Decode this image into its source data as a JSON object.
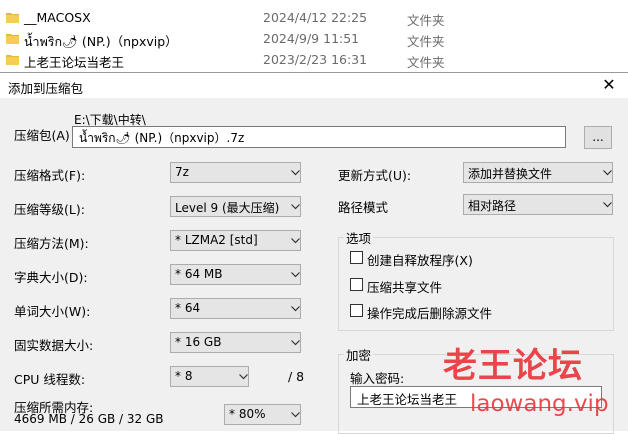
{
  "explorer": {
    "rows": [
      {
        "name": "__MACOSX",
        "date": "2024/4/12 22:25",
        "type": "文件夹"
      },
      {
        "name": "น้ำพริก🌶 (NP.)（npxvip）",
        "date": "2024/9/9 11:51",
        "type": "文件夹"
      },
      {
        "name": "上老王论坛当老王",
        "date": "2023/2/23 16:31",
        "type": "文件夹"
      }
    ]
  },
  "dialog": {
    "title": "添加到压缩包",
    "close": "✕",
    "archive_label": "压缩包(A)",
    "archive_path": "E:\\下载\\中转\\",
    "archive_name": "น้ำพริก🌶 (NP.)（npxvip）.7z",
    "browse": "...",
    "left": [
      {
        "label": "压缩格式(F):",
        "value": "7z"
      },
      {
        "label": "压缩等级(L):",
        "value": "Level 9 (最大压缩)"
      },
      {
        "label": "压缩方法(M):",
        "value": "* LZMA2 [std]"
      },
      {
        "label": "字典大小(D):",
        "value": "* 64 MB"
      },
      {
        "label": "单词大小(W):",
        "value": "* 64"
      },
      {
        "label": "固实数据大小:",
        "value": "* 16 GB"
      }
    ],
    "cpu": {
      "label": "CPU 线程数:",
      "value": "* 8",
      "total": "/ 8"
    },
    "memory": {
      "label": "压缩所需内存:",
      "detail": "4669 MB / 26 GB / 32 GB",
      "value": "* 80%"
    },
    "update": {
      "label": "更新方式(U):",
      "value": "添加并替换文件"
    },
    "path_mode": {
      "label": "路径模式",
      "value": "相对路径"
    },
    "options": {
      "title": "选项",
      "items": [
        {
          "label": "创建自释放程序(X)",
          "checked": false
        },
        {
          "label": "压缩共享文件",
          "checked": false
        },
        {
          "label": "操作完成后删除源文件",
          "checked": false
        }
      ]
    },
    "encryption": {
      "title": "加密",
      "password_label": "输入密码:",
      "password_value": "上老王论坛当老王"
    }
  },
  "watermark": {
    "line1": "老王论坛",
    "line2": "laowang.vip"
  },
  "colors": {
    "folder": "#e8b83a",
    "watermark": "#e8383d",
    "dialog_bg": "#f0f0f0"
  }
}
